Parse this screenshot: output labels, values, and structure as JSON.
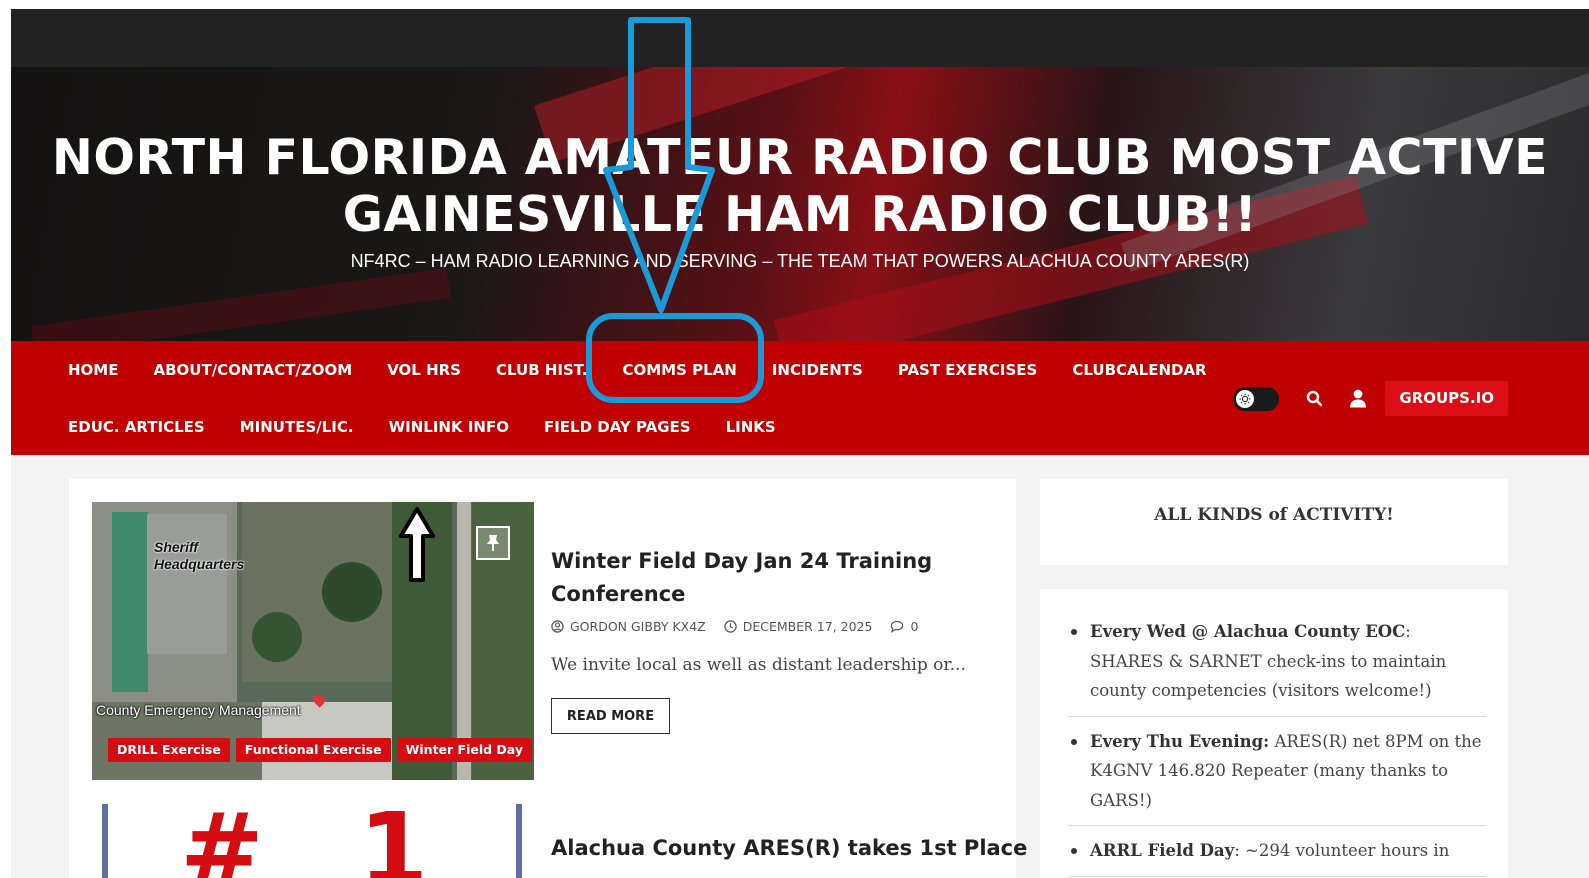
{
  "header": {
    "site_title": "NORTH FLORIDA AMATEUR RADIO CLUB MOST ACTIVE GAINESVILLE HAM RADIO CLUB!!",
    "tagline": "NF4RC – HAM RADIO LEARNING AND SERVING – THE TEAM THAT POWERS ALACHUA COUNTY ARES(R)"
  },
  "nav": {
    "row1": [
      "HOME",
      "ABOUT/CONTACT/ZOOM",
      "VOL HRS",
      "CLUB HIST.",
      "COMMS PLAN",
      "INCIDENTS",
      "PAST EXERCISES",
      "CLUBCALENDAR"
    ],
    "row2": [
      "EDUC. ARTICLES",
      "MINUTES/LIC.",
      "WINLINK INFO",
      "FIELD DAY PAGES",
      "LINKS"
    ],
    "groups_button": "GROUPS.IO",
    "icons": [
      "theme-toggle-icon",
      "search-icon",
      "user-icon"
    ]
  },
  "posts": [
    {
      "title": "Winter Field Day Jan 24 Training Conference",
      "author": "GORDON GIBBY KX4Z",
      "date": "DECEMBER 17, 2025",
      "comments": "0",
      "excerpt": "We invite local as well as distant leadership or...",
      "read_more": "READ MORE",
      "tags": [
        "DRILL Exercise",
        "Functional Exercise",
        "Winter Field Day"
      ],
      "image_labels": {
        "sheriff": "Sheriff Headquarters",
        "cem": "County Emergency Management"
      }
    },
    {
      "title": "Alachua County ARES(R) takes 1st Place",
      "image_text": "# 1"
    }
  ],
  "sidebar": {
    "title": "ALL KINDS of ACTIVITY!",
    "items": [
      {
        "bold": "Every Wed @ Alachua County EOC",
        "text": ": SHARES & SARNET check-ins to maintain county competencies (visitors welcome!)"
      },
      {
        "bold": "Every Thu Evening:",
        "text": " ARES(R) net 8PM on the K4GNV 146.820 Repeater (many thanks to GARS!)"
      },
      {
        "bold": "ARRL Field Day",
        "text": ": ~294 volunteer hours in"
      }
    ]
  },
  "colors": {
    "nav_red": "#c00000",
    "button_red": "#dd0f16",
    "tag_red": "#d40d12",
    "annotation_blue": "#1a9ad8"
  }
}
